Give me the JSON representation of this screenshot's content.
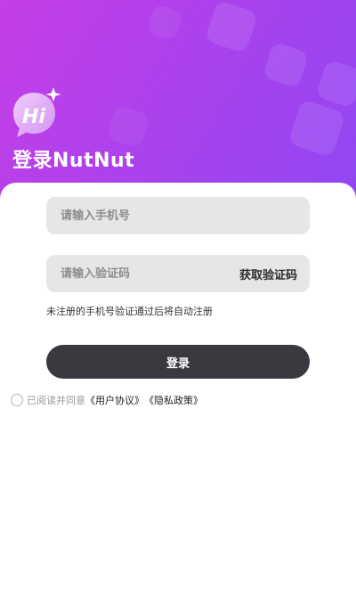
{
  "app": {
    "title": "登录NutNut",
    "logo_text": "Hi"
  },
  "form": {
    "phone_placeholder": "请输入手机号",
    "code_placeholder": "请输入验证码",
    "get_code_label": "获取验证码",
    "hint": "未注册的手机号验证通过后将自动注册",
    "login_label": "登录"
  },
  "agreement": {
    "prefix": "已阅读并同意",
    "user_agreement": "《用户协议》",
    "privacy_policy": "《隐私政策》"
  },
  "colors": {
    "gradient_start": "#c53ee6",
    "gradient_end": "#7a4ef7",
    "button": "#3b3840",
    "input_bg": "#e6e6e6"
  }
}
